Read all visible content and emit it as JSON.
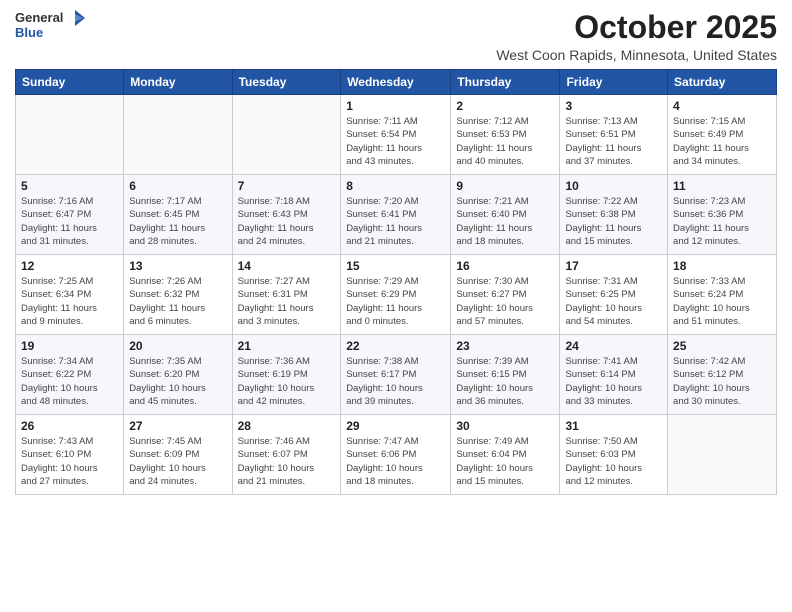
{
  "logo": {
    "general": "General",
    "blue": "Blue"
  },
  "title": "October 2025",
  "location": "West Coon Rapids, Minnesota, United States",
  "days_of_week": [
    "Sunday",
    "Monday",
    "Tuesday",
    "Wednesday",
    "Thursday",
    "Friday",
    "Saturday"
  ],
  "weeks": [
    [
      {
        "day": "",
        "info": ""
      },
      {
        "day": "",
        "info": ""
      },
      {
        "day": "",
        "info": ""
      },
      {
        "day": "1",
        "info": "Sunrise: 7:11 AM\nSunset: 6:54 PM\nDaylight: 11 hours\nand 43 minutes."
      },
      {
        "day": "2",
        "info": "Sunrise: 7:12 AM\nSunset: 6:53 PM\nDaylight: 11 hours\nand 40 minutes."
      },
      {
        "day": "3",
        "info": "Sunrise: 7:13 AM\nSunset: 6:51 PM\nDaylight: 11 hours\nand 37 minutes."
      },
      {
        "day": "4",
        "info": "Sunrise: 7:15 AM\nSunset: 6:49 PM\nDaylight: 11 hours\nand 34 minutes."
      }
    ],
    [
      {
        "day": "5",
        "info": "Sunrise: 7:16 AM\nSunset: 6:47 PM\nDaylight: 11 hours\nand 31 minutes."
      },
      {
        "day": "6",
        "info": "Sunrise: 7:17 AM\nSunset: 6:45 PM\nDaylight: 11 hours\nand 28 minutes."
      },
      {
        "day": "7",
        "info": "Sunrise: 7:18 AM\nSunset: 6:43 PM\nDaylight: 11 hours\nand 24 minutes."
      },
      {
        "day": "8",
        "info": "Sunrise: 7:20 AM\nSunset: 6:41 PM\nDaylight: 11 hours\nand 21 minutes."
      },
      {
        "day": "9",
        "info": "Sunrise: 7:21 AM\nSunset: 6:40 PM\nDaylight: 11 hours\nand 18 minutes."
      },
      {
        "day": "10",
        "info": "Sunrise: 7:22 AM\nSunset: 6:38 PM\nDaylight: 11 hours\nand 15 minutes."
      },
      {
        "day": "11",
        "info": "Sunrise: 7:23 AM\nSunset: 6:36 PM\nDaylight: 11 hours\nand 12 minutes."
      }
    ],
    [
      {
        "day": "12",
        "info": "Sunrise: 7:25 AM\nSunset: 6:34 PM\nDaylight: 11 hours\nand 9 minutes."
      },
      {
        "day": "13",
        "info": "Sunrise: 7:26 AM\nSunset: 6:32 PM\nDaylight: 11 hours\nand 6 minutes."
      },
      {
        "day": "14",
        "info": "Sunrise: 7:27 AM\nSunset: 6:31 PM\nDaylight: 11 hours\nand 3 minutes."
      },
      {
        "day": "15",
        "info": "Sunrise: 7:29 AM\nSunset: 6:29 PM\nDaylight: 11 hours\nand 0 minutes."
      },
      {
        "day": "16",
        "info": "Sunrise: 7:30 AM\nSunset: 6:27 PM\nDaylight: 10 hours\nand 57 minutes."
      },
      {
        "day": "17",
        "info": "Sunrise: 7:31 AM\nSunset: 6:25 PM\nDaylight: 10 hours\nand 54 minutes."
      },
      {
        "day": "18",
        "info": "Sunrise: 7:33 AM\nSunset: 6:24 PM\nDaylight: 10 hours\nand 51 minutes."
      }
    ],
    [
      {
        "day": "19",
        "info": "Sunrise: 7:34 AM\nSunset: 6:22 PM\nDaylight: 10 hours\nand 48 minutes."
      },
      {
        "day": "20",
        "info": "Sunrise: 7:35 AM\nSunset: 6:20 PM\nDaylight: 10 hours\nand 45 minutes."
      },
      {
        "day": "21",
        "info": "Sunrise: 7:36 AM\nSunset: 6:19 PM\nDaylight: 10 hours\nand 42 minutes."
      },
      {
        "day": "22",
        "info": "Sunrise: 7:38 AM\nSunset: 6:17 PM\nDaylight: 10 hours\nand 39 minutes."
      },
      {
        "day": "23",
        "info": "Sunrise: 7:39 AM\nSunset: 6:15 PM\nDaylight: 10 hours\nand 36 minutes."
      },
      {
        "day": "24",
        "info": "Sunrise: 7:41 AM\nSunset: 6:14 PM\nDaylight: 10 hours\nand 33 minutes."
      },
      {
        "day": "25",
        "info": "Sunrise: 7:42 AM\nSunset: 6:12 PM\nDaylight: 10 hours\nand 30 minutes."
      }
    ],
    [
      {
        "day": "26",
        "info": "Sunrise: 7:43 AM\nSunset: 6:10 PM\nDaylight: 10 hours\nand 27 minutes."
      },
      {
        "day": "27",
        "info": "Sunrise: 7:45 AM\nSunset: 6:09 PM\nDaylight: 10 hours\nand 24 minutes."
      },
      {
        "day": "28",
        "info": "Sunrise: 7:46 AM\nSunset: 6:07 PM\nDaylight: 10 hours\nand 21 minutes."
      },
      {
        "day": "29",
        "info": "Sunrise: 7:47 AM\nSunset: 6:06 PM\nDaylight: 10 hours\nand 18 minutes."
      },
      {
        "day": "30",
        "info": "Sunrise: 7:49 AM\nSunset: 6:04 PM\nDaylight: 10 hours\nand 15 minutes."
      },
      {
        "day": "31",
        "info": "Sunrise: 7:50 AM\nSunset: 6:03 PM\nDaylight: 10 hours\nand 12 minutes."
      },
      {
        "day": "",
        "info": ""
      }
    ]
  ]
}
